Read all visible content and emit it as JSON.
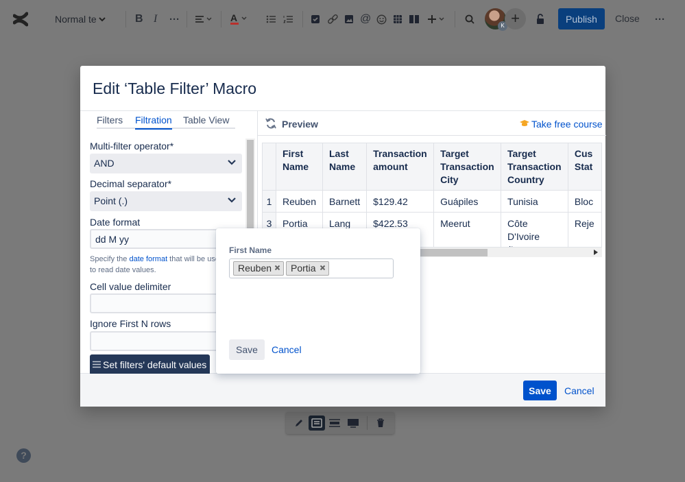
{
  "toolbar": {
    "text_style": "Normal te",
    "publish_label": "Publish",
    "close_label": "Close",
    "avatar_badge": "K",
    "icons": [
      "confluence-logo",
      "bold",
      "italic",
      "more-formatting",
      "align",
      "text-color",
      "bullet-list",
      "numbered-list",
      "task",
      "link",
      "image",
      "mention",
      "emoji",
      "table",
      "layouts",
      "insert",
      "find",
      "restrictions",
      "more"
    ]
  },
  "modal": {
    "title": "Edit ‘Table Filter’ Macro",
    "tabs": [
      "Filters",
      "Filtration",
      "Table View"
    ],
    "active_tab": "Filtration",
    "fields": {
      "multi_filter_label": "Multi-filter operator*",
      "multi_filter_value": "AND",
      "decimal_label": "Decimal separator*",
      "decimal_value": "Point (.)",
      "date_label": "Date format",
      "date_value": "dd M yy",
      "hint_prefix": "Specify the ",
      "hint_link": "date format",
      "hint_suffix": " that will be used to read date values.",
      "delimiter_label": "Cell value delimiter",
      "delimiter_value": "",
      "ignore_label": "Ignore First N rows",
      "ignore_value": ""
    },
    "set_defaults_label": "Set filters' default values",
    "preview": {
      "title": "Preview",
      "course_link": "Take free course",
      "headers": [
        "",
        "First Name",
        "Last Name",
        "Transaction amount",
        "Target Transaction City",
        "Target Transaction Country",
        "Cus Stat"
      ],
      "rows": [
        [
          "1",
          "Reuben",
          "Barnett",
          "$129.42",
          "Guápiles",
          "Tunisia",
          "Bloc"
        ],
        [
          "3",
          "Portia",
          "Lang",
          "$422.53",
          "Meerut",
          "Côte D'Ivoire (Ivory Coast)",
          "Reje"
        ]
      ]
    },
    "save_label": "Save",
    "cancel_label": "Cancel"
  },
  "popup": {
    "field_label": "First Name",
    "chips": [
      "Reuben",
      "Portia"
    ],
    "save_label": "Save",
    "cancel_label": "Cancel"
  },
  "colors": {
    "primary": "#0052cc",
    "publish": "#0a3f7d",
    "dark_button": "#253858",
    "overlay": "#7a7a7a"
  }
}
